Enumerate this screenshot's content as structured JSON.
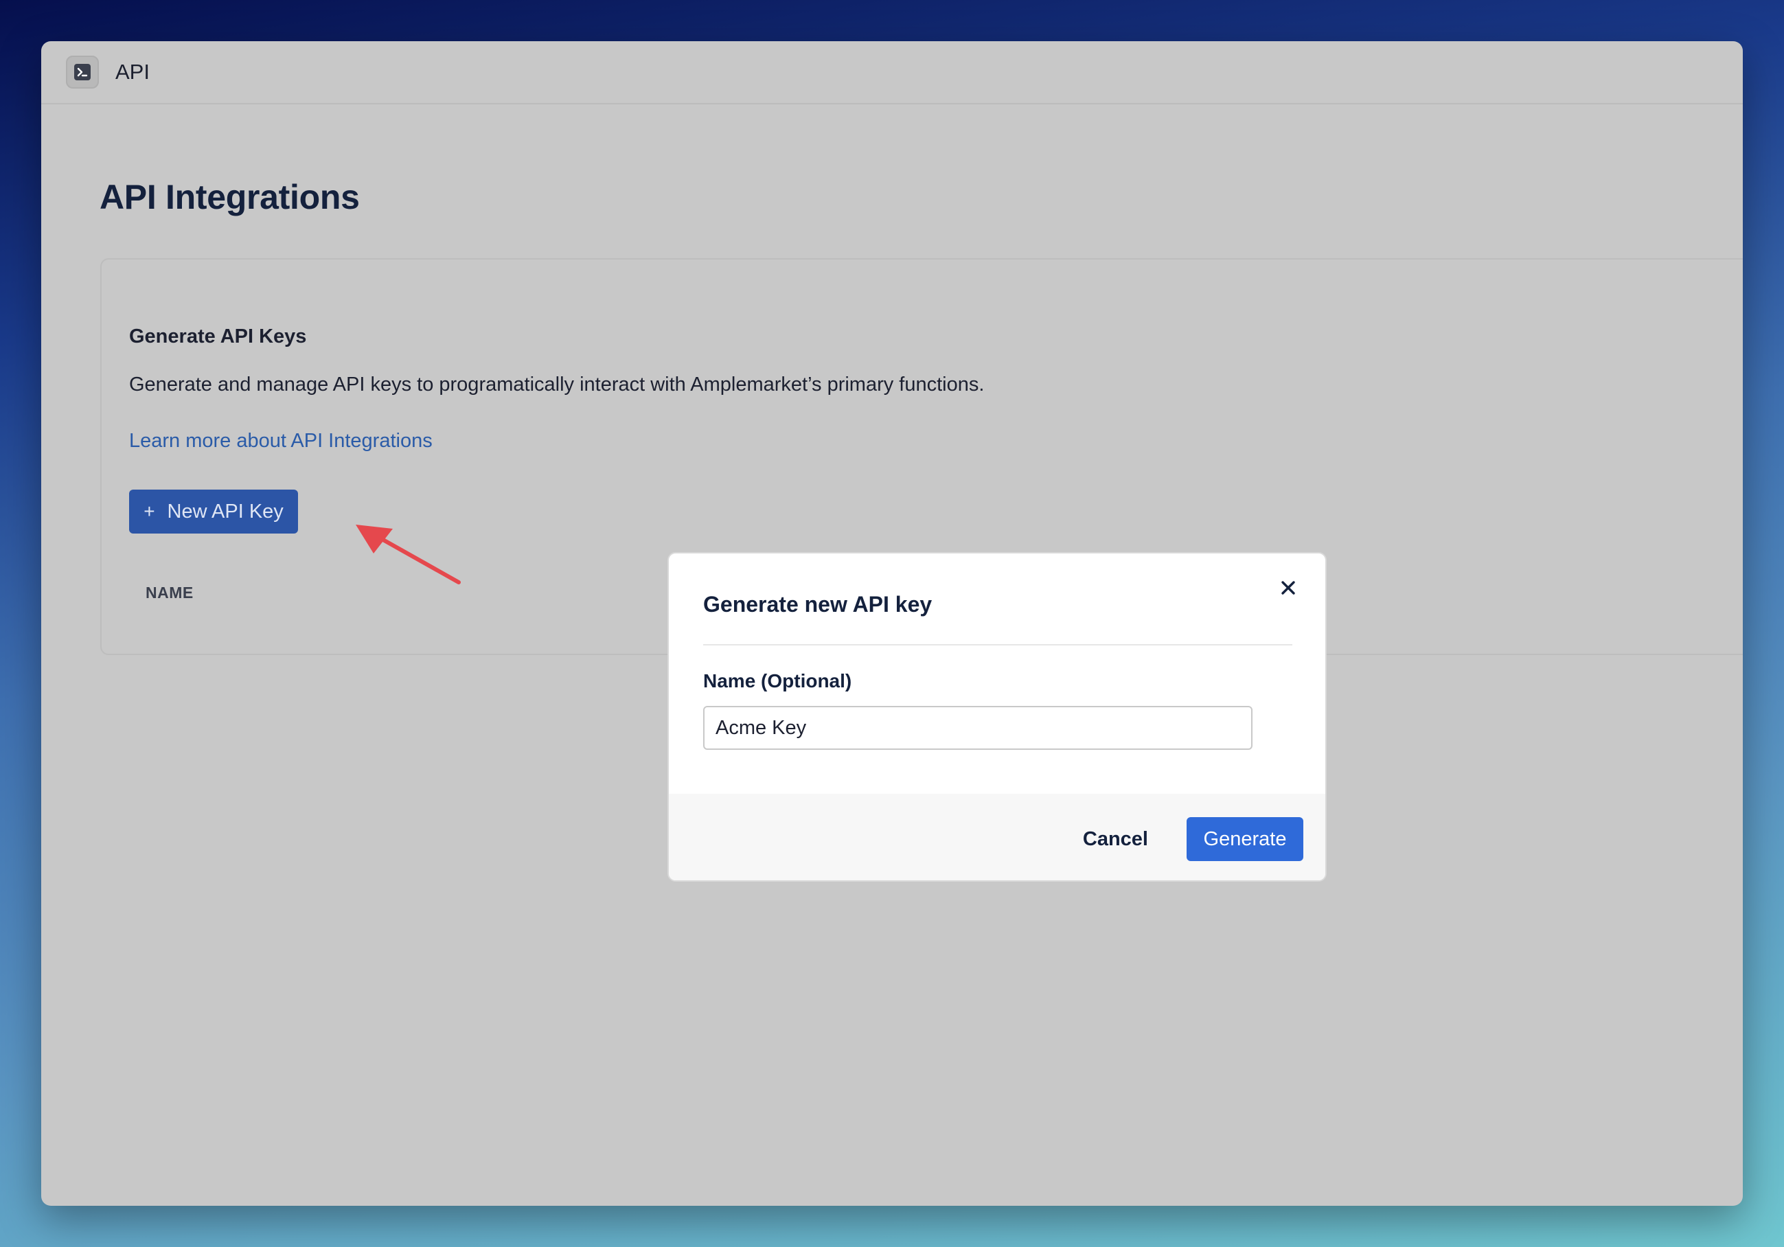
{
  "topbar": {
    "icon": "terminal-icon",
    "title": "API"
  },
  "page": {
    "title": "API Integrations"
  },
  "card": {
    "heading": "Generate API Keys",
    "description": "Generate and manage API keys to programatically interact with Amplemarket’s primary functions.",
    "learn_link": "Learn more about API Integrations",
    "new_key_button": "New API Key",
    "new_key_icon": "+",
    "table_header_name": "NAME"
  },
  "modal": {
    "title": "Generate new API key",
    "close_icon": "close-icon",
    "field_label": "Name (Optional)",
    "field_value": "Acme Key",
    "cancel_label": "Cancel",
    "generate_label": "Generate"
  },
  "colors": {
    "accent": "#2f6ad9",
    "link": "#2a5ba8",
    "annotation_arrow": "#e5484d"
  }
}
